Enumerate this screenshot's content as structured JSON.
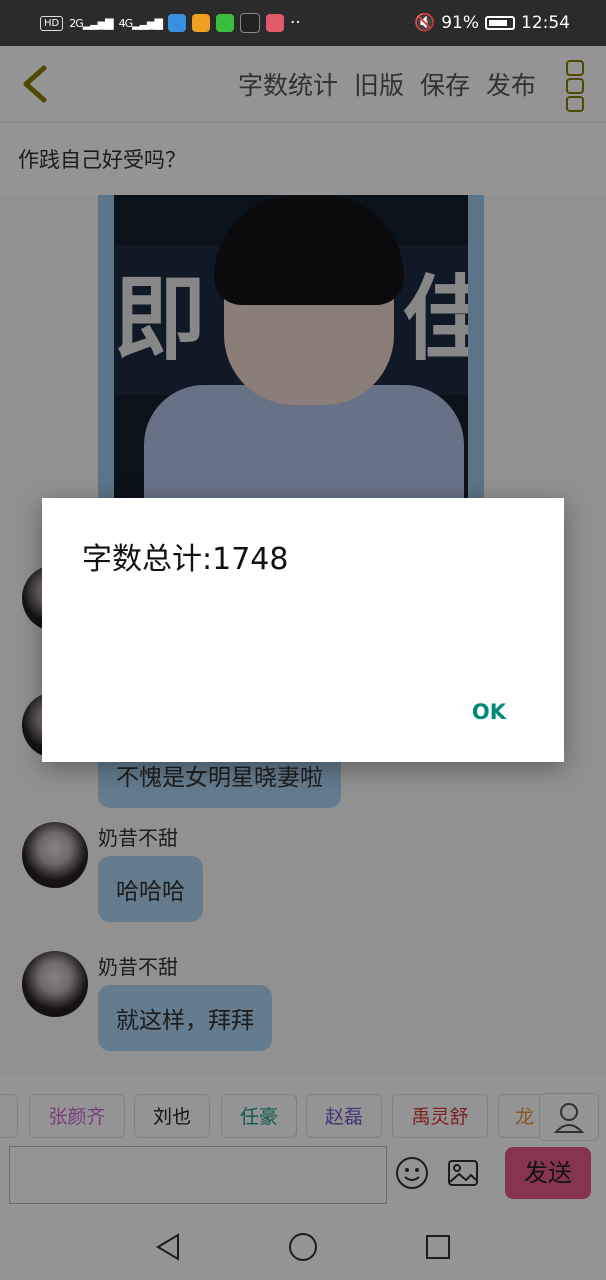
{
  "status_bar": {
    "hd": "HD",
    "net1": "2G",
    "net2": "4G",
    "battery": "91%",
    "time": "12:54",
    "dots": "··"
  },
  "toolbar": {
    "word_count": "字数统计",
    "old_version": "旧版",
    "save": "保存",
    "publish": "发布"
  },
  "title": "作践自己好受吗？",
  "photo": {
    "sign_text": "即 咭 佳"
  },
  "messages": [
    {
      "sender": "奶昔不甜",
      "text": "哈哈哈"
    },
    {
      "sender": "奶昔不甜",
      "text": "就这样，拜拜"
    }
  ],
  "partial_bubble": "不愧是女明星晓妻啦",
  "chips": [
    {
      "label": "张颜齐",
      "color": "#d16ad9"
    },
    {
      "label": "刘也",
      "color": "#222222"
    },
    {
      "label": "任豪",
      "color": "#1a9a8a"
    },
    {
      "label": "赵磊",
      "color": "#7b5ac9"
    },
    {
      "label": "禹灵舒",
      "color": "#d93a3a"
    },
    {
      "label": "龙",
      "color": "#e8963a"
    }
  ],
  "send": "发送",
  "dialog": {
    "message": "字数总计:1748",
    "ok": "OK"
  },
  "colors": {
    "accent": "#00897b",
    "bubble": "#acd6f5",
    "send_bg": "#e75a8a",
    "back_arrow": "#8a7a00"
  }
}
